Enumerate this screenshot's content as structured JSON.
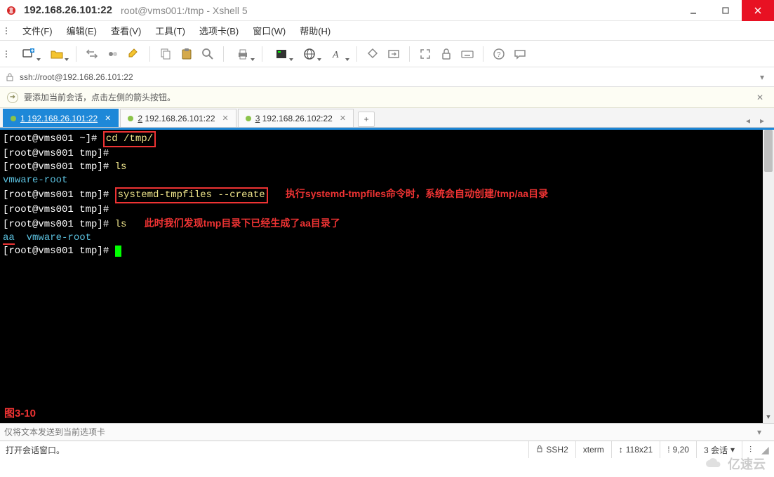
{
  "window": {
    "ip_title": "192.168.26.101:22",
    "full_title": "root@vms001:/tmp - Xshell 5"
  },
  "menu": {
    "file": "文件(F)",
    "edit": "编辑(E)",
    "view": "查看(V)",
    "tools": "工具(T)",
    "tabs": "选项卡(B)",
    "window": "窗口(W)",
    "help": "帮助(H)"
  },
  "addressbar": {
    "url": "ssh://root@192.168.26.101:22"
  },
  "infobar": {
    "message": "要添加当前会话，点击左侧的箭头按钮。"
  },
  "tabs": [
    {
      "num": "1",
      "label": "192.168.26.101:22",
      "active": true
    },
    {
      "num": "2",
      "label": "192.168.26.101:22",
      "active": false
    },
    {
      "num": "3",
      "label": "192.168.26.102:22",
      "active": false
    }
  ],
  "terminal": {
    "l1_prompt": "[root@vms001 ~]# ",
    "l1_cmd": "cd /tmp/",
    "l2": "[root@vms001 tmp]#",
    "l3_prompt": "[root@vms001 tmp]# ",
    "l3_cmd": "ls",
    "l4": "vmware-root",
    "l5_prompt": "[root@vms001 tmp]# ",
    "l5_cmd": "systemd-tmpfiles --create",
    "l5_note": "执行systemd-tmpfiles命令时，系统会自动创建/tmp/aa目录",
    "l6": "[root@vms001 tmp]#",
    "l7_prompt": "[root@vms001 tmp]# ",
    "l7_cmd": "ls",
    "l7_note": "此时我们发现tmp目录下已经生成了aa目录了",
    "l8_aa": "aa",
    "l8_rest": "  vmware-root",
    "l9": "[root@vms001 tmp]# ",
    "figure": "图3-10"
  },
  "sendbar": {
    "placeholder": "仅将文本发送到当前选项卡"
  },
  "statusbar": {
    "msg": "打开会话窗口。",
    "proto": "SSH2",
    "term": "xterm",
    "size_icon": "↕",
    "size": "118x21",
    "pos_icon": "⁞",
    "pos": "9,20",
    "sessions": "3 会话",
    "sess_dd": "▾",
    "caps_dd": "⫶"
  },
  "watermark": {
    "text": "亿速云"
  },
  "icons": {
    "newtab": "+"
  }
}
